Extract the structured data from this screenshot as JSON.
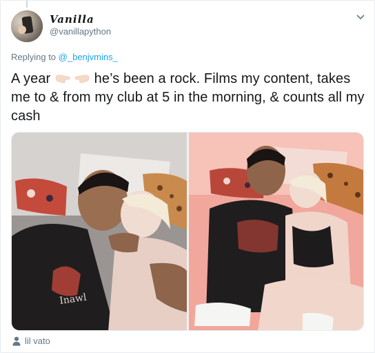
{
  "user": {
    "display_name": "Vanilla",
    "handle": "@vanillapython"
  },
  "reply": {
    "prefix": "Replying to ",
    "to_handle": "@_benjvmins_"
  },
  "tweet": {
    "text_before_emoji": "A year ",
    "emoji": "pointing-hands-icon",
    "text_after_emoji": " he’s been a rock. Films my content, takes me to & from my club at 5 in the morning, & counts all my cash"
  },
  "media": {
    "count": 2,
    "photo_1": "couple-photo-icon",
    "photo_2": "couple-photo-icon"
  },
  "footer": {
    "tagged_user": "lil vato",
    "icon": "person-icon"
  },
  "colors": {
    "link": "#1da1f2",
    "secondary_text": "#657786",
    "primary_text": "#14171a",
    "border": "#e6ecf0"
  }
}
